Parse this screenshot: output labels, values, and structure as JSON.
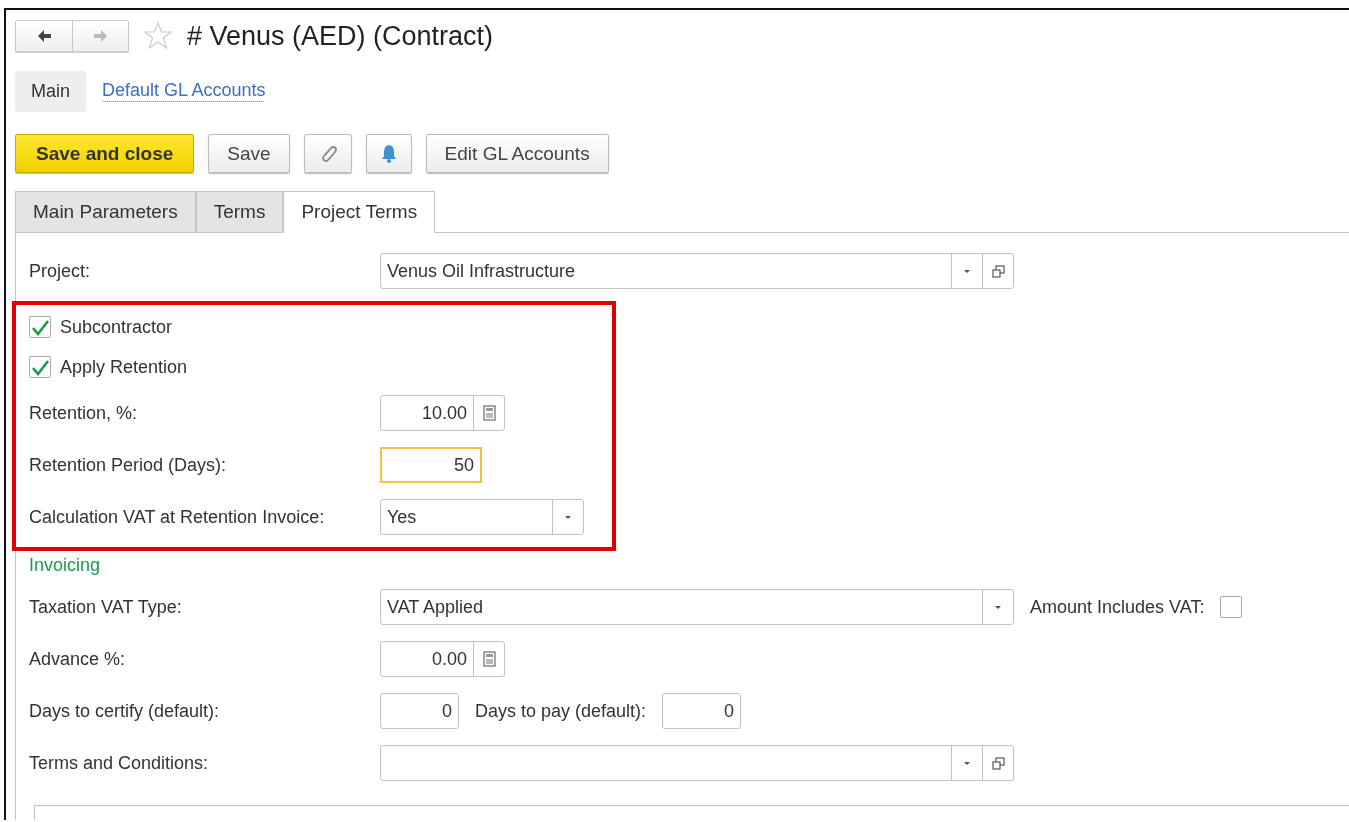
{
  "title": "# Venus (AED) (Contract)",
  "favorite": false,
  "nav": [
    {
      "kind": "back",
      "disabled": false
    },
    {
      "kind": "forward",
      "disabled": true
    }
  ],
  "header_tabs": [
    {
      "label": "Main",
      "selected": true
    },
    {
      "label": "Default GL Accounts",
      "selected": false
    }
  ],
  "commands": [
    {
      "kind": "primary",
      "label": "Save and close"
    },
    {
      "kind": "text",
      "label": "Save"
    },
    {
      "kind": "attach"
    },
    {
      "kind": "bell"
    },
    {
      "kind": "text",
      "label": "Edit GL Accounts"
    }
  ],
  "tabs": [
    {
      "label": "Main Parameters",
      "selected": false
    },
    {
      "label": "Terms",
      "selected": false
    },
    {
      "label": "Project Terms",
      "selected": true
    }
  ],
  "groups": [
    {
      "highlighted": false,
      "rows": [
        {
          "kind": "field",
          "label": "Project:",
          "controls": [
            {
              "kind": "lookup",
              "value": "Venus Oil Infrastructure"
            }
          ]
        }
      ]
    },
    {
      "highlighted": true,
      "rows": [
        {
          "kind": "checkbox",
          "label": "Subcontractor",
          "checked": true
        },
        {
          "kind": "checkbox",
          "label": "Apply Retention",
          "checked": true
        },
        {
          "kind": "field",
          "label": "Retention, %:",
          "controls": [
            {
              "kind": "calc",
              "value": "10.00"
            }
          ]
        },
        {
          "kind": "field",
          "label": "Retention Period (Days):",
          "controls": [
            {
              "kind": "number",
              "value": "50",
              "focused": true
            }
          ]
        },
        {
          "kind": "field",
          "label": "Calculation VAT at Retention Invoice:",
          "controls": [
            {
              "kind": "select",
              "value": "Yes"
            }
          ]
        }
      ]
    },
    {
      "highlighted": false,
      "rows": [
        {
          "kind": "section",
          "label": "Invoicing"
        },
        {
          "kind": "field",
          "label": "Taxation VAT Type:",
          "controls": [
            {
              "kind": "combo",
              "value": "VAT Applied"
            },
            {
              "kind": "checkbox",
              "label": "Amount Includes VAT:",
              "checked": false
            }
          ]
        },
        {
          "kind": "field",
          "label": "Advance %:",
          "controls": [
            {
              "kind": "calc",
              "value": "0.00"
            }
          ]
        },
        {
          "kind": "field",
          "label": "Days to certify (default):",
          "controls": [
            {
              "kind": "number",
              "value": "0",
              "focused": false
            },
            {
              "kind": "number",
              "label": "Days to pay (default):",
              "value": "0",
              "focused": false
            }
          ]
        },
        {
          "kind": "field",
          "label": "Terms and Conditions:",
          "controls": [
            {
              "kind": "lookup"
            }
          ]
        }
      ]
    }
  ],
  "memo": {
    "kind": "memo"
  }
}
